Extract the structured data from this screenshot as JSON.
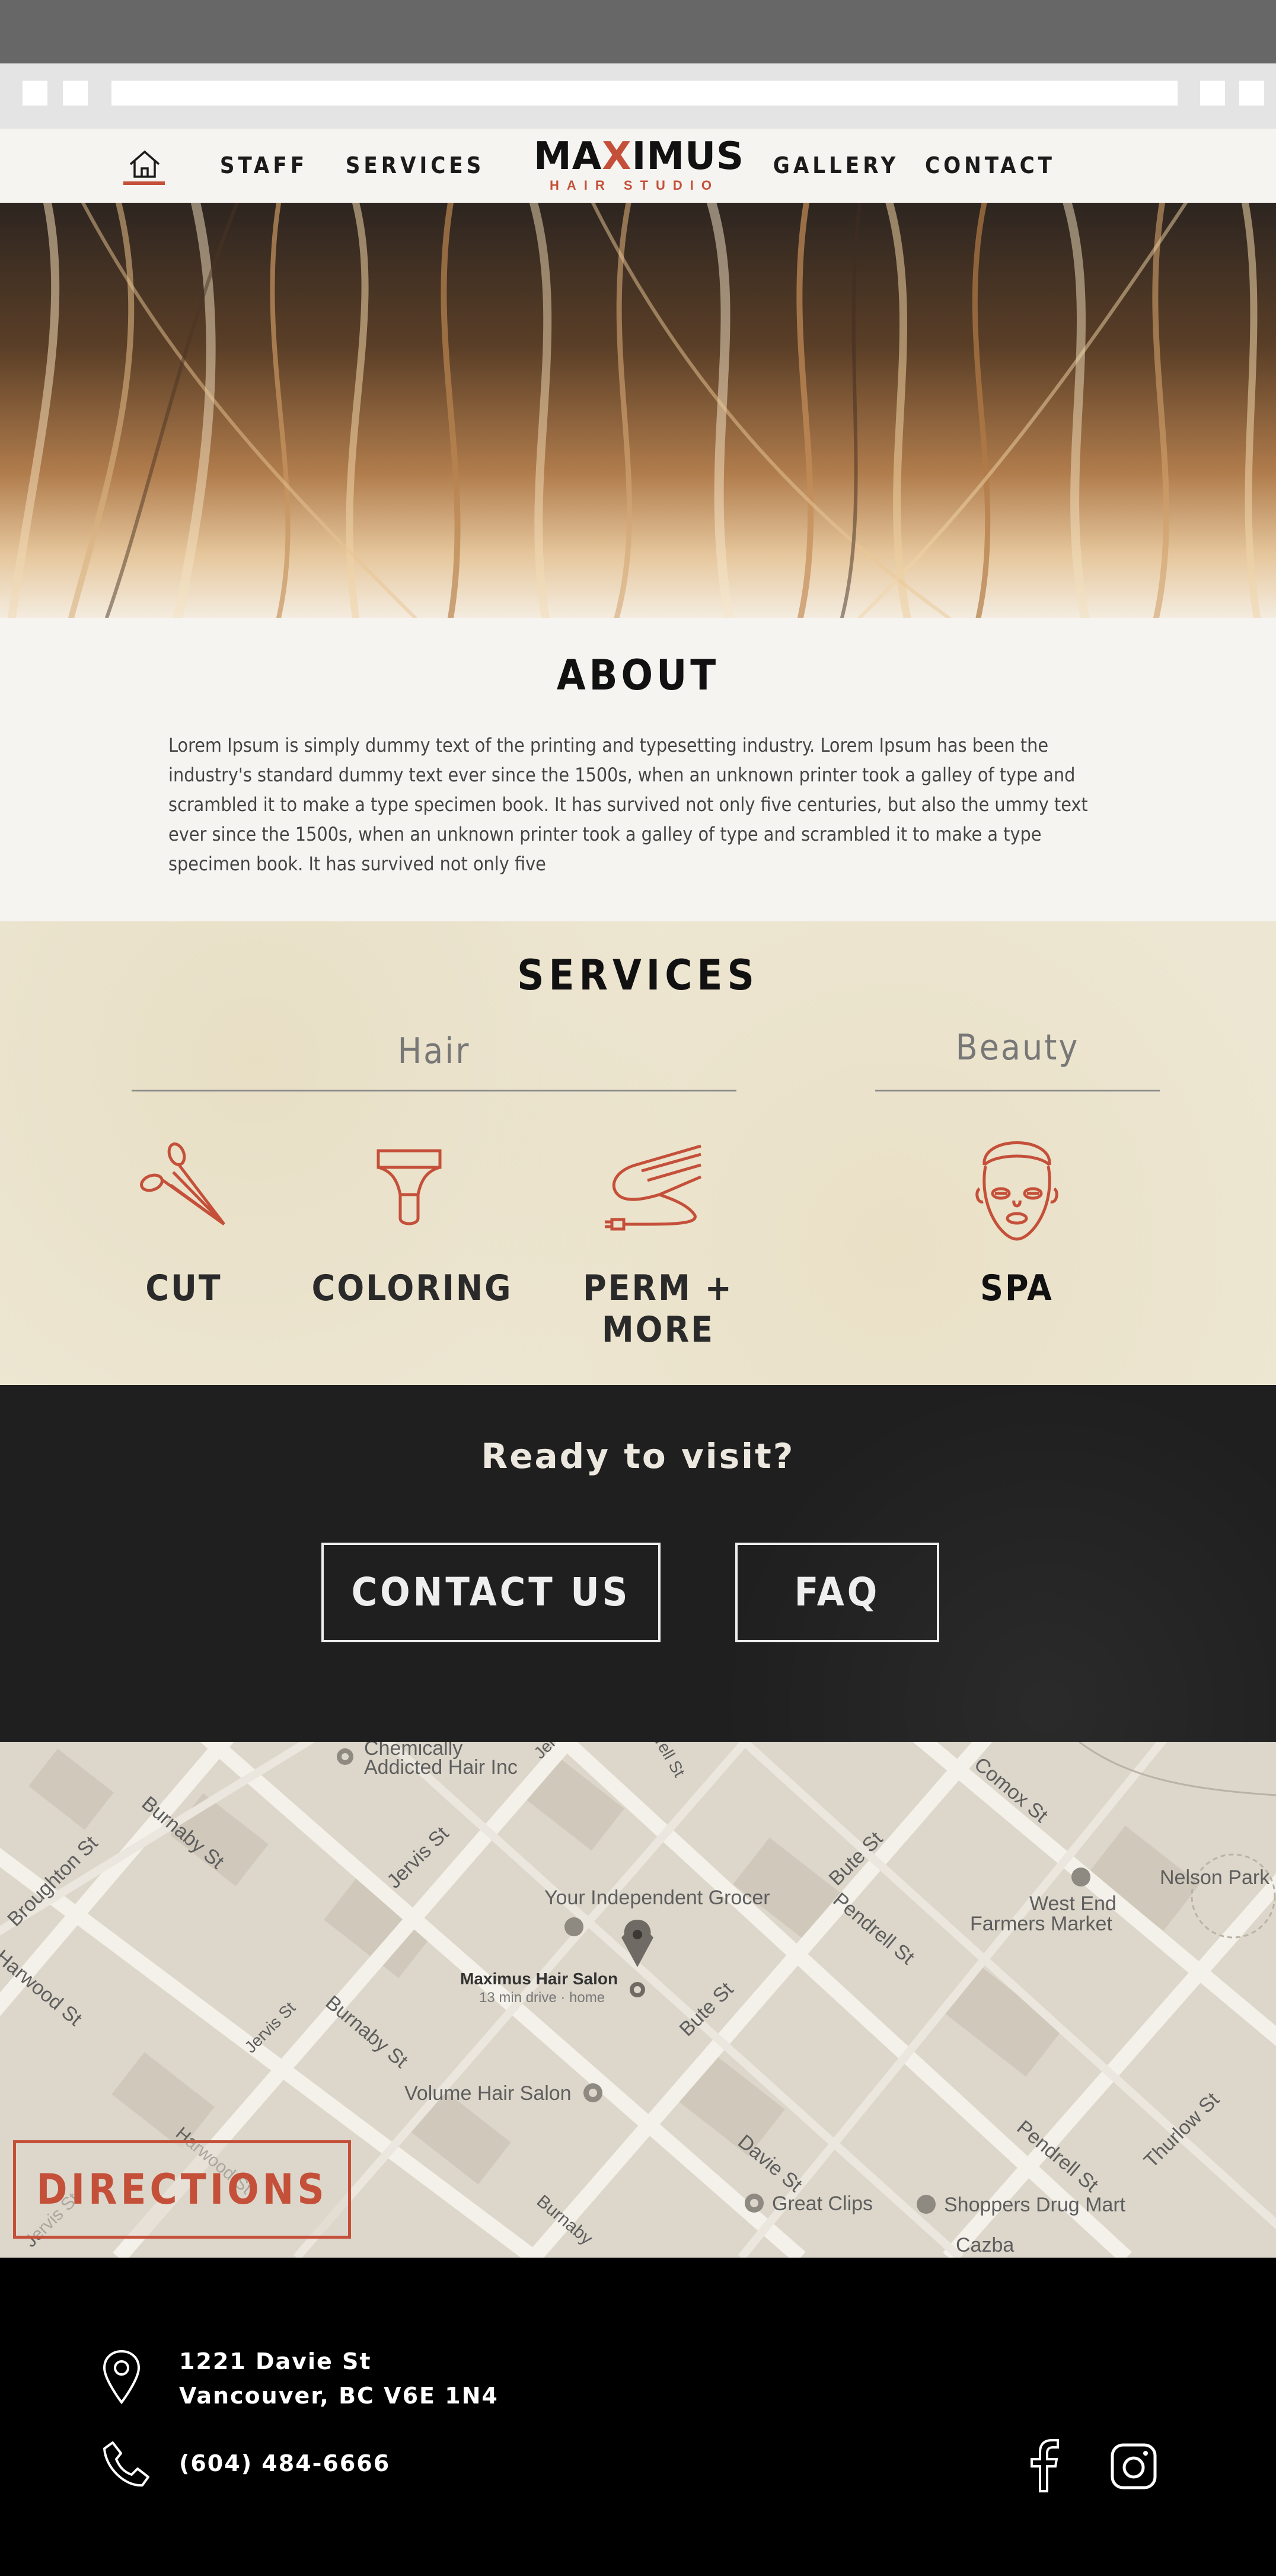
{
  "nav": {
    "staff": "STAFF",
    "services": "SERVICES",
    "gallery": "GALLERY",
    "contact": "CONTACT"
  },
  "logo": {
    "name_pre": "MA",
    "name_x": "X",
    "name_post": "IMUS",
    "subtitle": "HAIR STUDIO"
  },
  "about": {
    "title": "ABOUT",
    "text": "Lorem Ipsum is simply dummy text of the printing and typesetting industry. Lorem Ipsum has been the industry's standard dummy text ever since the 1500s, when an unknown printer took a galley of type and scrambled it to make a type specimen book. It has survived not only five centuries, but also the ummy text ever since the 1500s, when an unknown printer took a galley of type and scrambled it to make a type specimen book. It has survived not only five"
  },
  "services": {
    "title": "SERVICES",
    "categories": {
      "hair": "Hair",
      "beauty": "Beauty"
    },
    "items": [
      {
        "label": "CUT",
        "icon": "scissors-icon"
      },
      {
        "label": "COLORING",
        "icon": "hair-dye-brush-icon"
      },
      {
        "label": "PERM + MORE",
        "icon": "hair-straightener-icon"
      },
      {
        "label": "SPA",
        "icon": "face-mask-icon"
      }
    ]
  },
  "cta": {
    "title": "Ready to visit?",
    "contact_button": "CONTACT US",
    "faq_button": "FAQ"
  },
  "map": {
    "labels": {
      "chemically": "Chemically",
      "addicted": "Addicted Hair Inc",
      "grocer": "Your Independent Grocer",
      "maximus": "Maximus Hair Salon",
      "drive": "13 min drive · home",
      "volume": "Volume Hair Salon",
      "great_clips": "Great Clips",
      "shoppers": "Shoppers Drug Mart",
      "west_end": "West End",
      "farmers": "Farmers Market",
      "nelson": "Nelson Park",
      "cazba": "Cazba",
      "st_burnaby1": "Burnaby St",
      "st_jervis1": "Jervis St",
      "st_broughton": "Broughton St",
      "st_harwood": "Harwood St",
      "st_jervis2": "Jervis St",
      "st_burnaby2": "Burnaby St",
      "st_bute1": "Bute St",
      "st_bute2": "Bute St",
      "st_pendrell1": "Pendrell St",
      "st_pendrell2": "Pendrell St",
      "st_comox": "Comox St",
      "st_davie": "Davie St",
      "st_thurlow": "Thurlow St",
      "st_harwood2": "Harwood St",
      "st_jervis3": "Jervis St",
      "st_burnaby3": "Burnaby",
      "st_top1": "Jer",
      "st_top2": "rell St"
    },
    "directions": "DIRECTIONS"
  },
  "footer": {
    "address_line1": "1221 Davie St",
    "address_line2": "Vancouver, BC V6E 1N4",
    "phone": "(604) 484-6666"
  },
  "colors": {
    "accent": "#c5503a",
    "dark": "#1f1f1f",
    "cream": "#ede6d2"
  }
}
